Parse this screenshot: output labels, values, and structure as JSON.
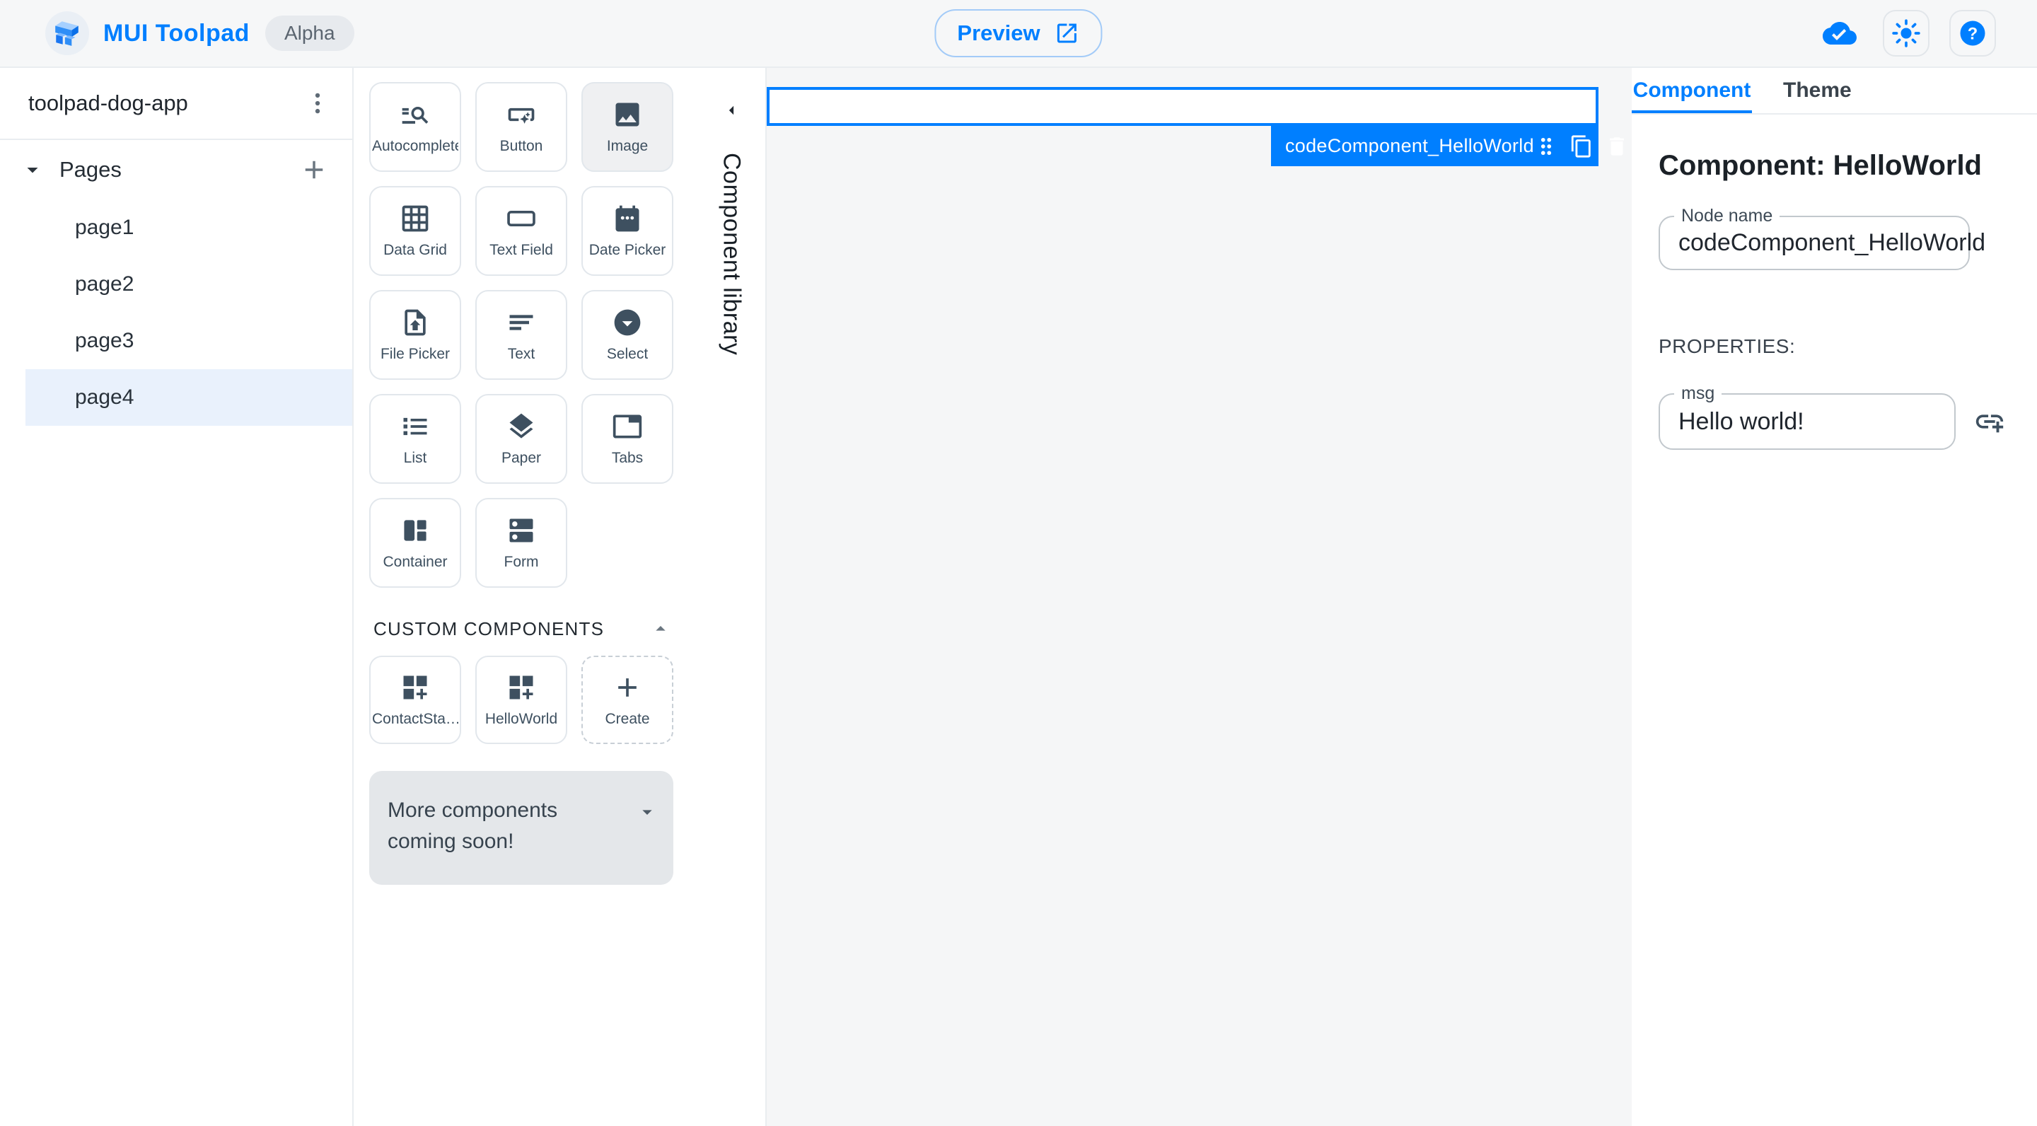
{
  "colors": {
    "accent": "#007FFF",
    "selection_outline": "#007FFF",
    "page_selected_bg": "#E9F1FC",
    "icon_slate": "#3E5060",
    "header_bg": "#F6F7F8",
    "canvas_bg": "#F5F6F7"
  },
  "header": {
    "app_title": "MUI Toolpad",
    "alpha_badge": "Alpha",
    "preview_label": "Preview"
  },
  "sidebar": {
    "app_name": "toolpad-dog-app",
    "pages_label": "Pages",
    "pages": [
      {
        "label": "page1",
        "selected": false
      },
      {
        "label": "page2",
        "selected": false
      },
      {
        "label": "page3",
        "selected": false
      },
      {
        "label": "page4",
        "selected": true
      }
    ]
  },
  "library": {
    "panel_title": "Component library",
    "components": [
      {
        "label": "Autocomplete",
        "icon": "autocomplete",
        "selected": false
      },
      {
        "label": "Button",
        "icon": "smart-button",
        "selected": false
      },
      {
        "label": "Image",
        "icon": "image",
        "selected": true
      },
      {
        "label": "Data Grid",
        "icon": "data-grid",
        "selected": false
      },
      {
        "label": "Text Field",
        "icon": "text-field",
        "selected": false
      },
      {
        "label": "Date Picker",
        "icon": "date-picker",
        "selected": false
      },
      {
        "label": "File Picker",
        "icon": "file-picker",
        "selected": false
      },
      {
        "label": "Text",
        "icon": "text",
        "selected": false
      },
      {
        "label": "Select",
        "icon": "select",
        "selected": false
      },
      {
        "label": "List",
        "icon": "list",
        "selected": false
      },
      {
        "label": "Paper",
        "icon": "paper",
        "selected": false
      },
      {
        "label": "Tabs",
        "icon": "tabs",
        "selected": false
      },
      {
        "label": "Container",
        "icon": "container",
        "selected": false
      },
      {
        "label": "Form",
        "icon": "form",
        "selected": false
      }
    ],
    "custom_section": {
      "title": "CUSTOM COMPONENTS",
      "components": [
        {
          "label": "ContactSta…",
          "icon": "custom-component"
        },
        {
          "label": "HelloWorld",
          "icon": "custom-component"
        }
      ],
      "create_label": "Create"
    },
    "coming_soon_text": "More components coming soon!"
  },
  "canvas": {
    "selected_node_label": "codeComponent_HelloWorld"
  },
  "inspector": {
    "tabs": [
      {
        "label": "Component",
        "active": true
      },
      {
        "label": "Theme",
        "active": false
      }
    ],
    "heading": "Component: HelloWorld",
    "node_name": {
      "label": "Node name",
      "value": "codeComponent_HelloWorld"
    },
    "properties_label": "PROPERTIES:",
    "msg": {
      "label": "msg",
      "value": "Hello world!"
    }
  }
}
